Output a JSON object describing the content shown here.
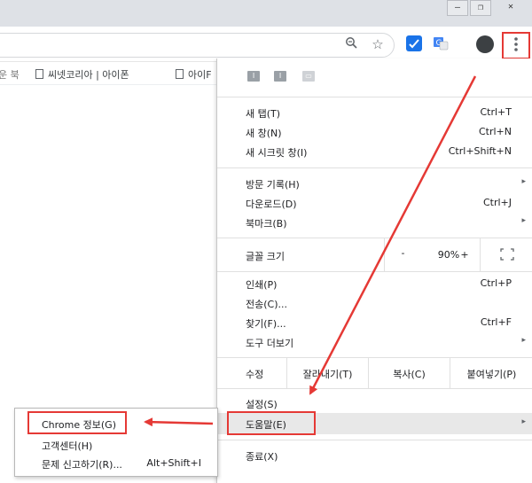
{
  "window": {
    "minimize": "—",
    "restore": "❐",
    "close": "✕"
  },
  "bookmarks": [
    {
      "label": "운 북"
    },
    {
      "label": "씨넷코리아 | 아이폰"
    },
    {
      "label": "아이F"
    }
  ],
  "menu": {
    "top_icons": [
      "I",
      "I",
      "▭"
    ],
    "items": {
      "new_tab": {
        "label": "새 탭(T)",
        "shortcut": "Ctrl+T"
      },
      "new_window": {
        "label": "새 창(N)",
        "shortcut": "Ctrl+N"
      },
      "incognito": {
        "label": "새 시크릿 창(I)",
        "shortcut": "Ctrl+Shift+N"
      },
      "history": {
        "label": "방문 기록(H)"
      },
      "downloads": {
        "label": "다운로드(D)",
        "shortcut": "Ctrl+J"
      },
      "bookmarks": {
        "label": "북마크(B)"
      },
      "zoom": {
        "label": "글꼴 크기",
        "minus": "-",
        "value": "90%",
        "plus": "+"
      },
      "print": {
        "label": "인쇄(P)",
        "shortcut": "Ctrl+P"
      },
      "cast": {
        "label": "전송(C)..."
      },
      "find": {
        "label": "찾기(F)...",
        "shortcut": "Ctrl+F"
      },
      "more_tools": {
        "label": "도구 더보기"
      },
      "edit": {
        "label": "수정",
        "cut": "잘라내기(T)",
        "copy": "복사(C)",
        "paste": "붙여넣기(P)"
      },
      "settings": {
        "label": "설정(S)"
      },
      "help": {
        "label": "도움말(E)"
      },
      "exit": {
        "label": "종료(X)"
      }
    },
    "arrow": "▸"
  },
  "help_submenu": {
    "about": {
      "label": "Chrome 정보(G)"
    },
    "help_center": {
      "label": "고객센터(H)"
    },
    "report": {
      "label": "문제 신고하기(R)...",
      "shortcut": "Alt+Shift+I"
    }
  },
  "colors": {
    "highlight": "#e53935",
    "hover": "#e8e8e8"
  }
}
